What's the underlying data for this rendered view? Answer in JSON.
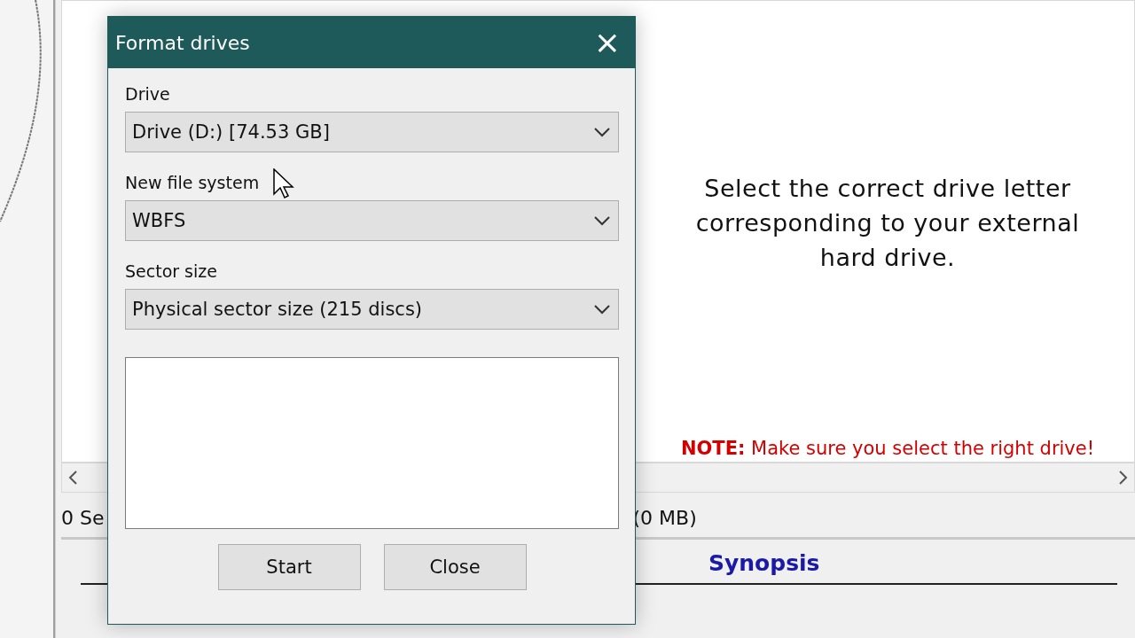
{
  "background": {
    "status_left": "0 Se",
    "status_right": "(0 MB)",
    "section_header": "Synopsis"
  },
  "dialog": {
    "title": "Format drives",
    "close": "×",
    "fields": [
      {
        "label": "Drive",
        "value": "Drive (D:) [74.53 GB]"
      },
      {
        "label": "New file system",
        "value": "WBFS"
      },
      {
        "label": "Sector size",
        "value": "Physical sector size (215 discs)"
      }
    ],
    "buttons": [
      "Start",
      "Close"
    ]
  },
  "annotation": {
    "text": "Select the correct drive letter corresponding to your external hard drive.",
    "note": "**NOTE:** Make sure you select the right drive!"
  }
}
